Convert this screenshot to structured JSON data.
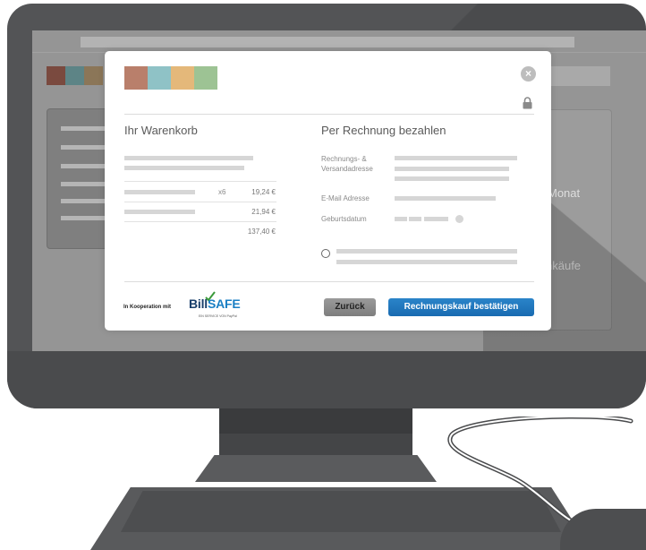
{
  "background_page": {
    "side_text_1": "Monat",
    "side_text_2": "nkäufe",
    "tile_colors": [
      "#7a4a3f",
      "#5d8486",
      "#8b7658"
    ]
  },
  "modal": {
    "swatch_colors": [
      "#b97f6b",
      "#8fc2c6",
      "#e4b87a",
      "#9dc394"
    ],
    "close_label": "×",
    "cart": {
      "title": "Ihr Warenkorb",
      "rows": [
        {
          "qty": "x6",
          "price": "19,24 €"
        },
        {
          "qty": "",
          "price": "21,94 €"
        }
      ],
      "total": "137,40 €"
    },
    "payment": {
      "title": "Per Rechnung bezahlen",
      "address_label": "Rechnungs- & Versandadresse",
      "email_label": "E-Mail Adresse",
      "birthdate_label": "Geburtsdatum"
    },
    "footer": {
      "cooperation_text": "In Kooperation mit",
      "logo_bill": "Bill",
      "logo_safe": "SAFE",
      "logo_tagline": "EIN SERVICE VON PayPal",
      "back_label": "Zurück",
      "confirm_label": "Rechnungskauf bestätigen"
    }
  },
  "colors": {
    "confirm_button": "#1f74bb",
    "back_button": "#8c8c8c",
    "monitor": "#4a4b4d"
  }
}
